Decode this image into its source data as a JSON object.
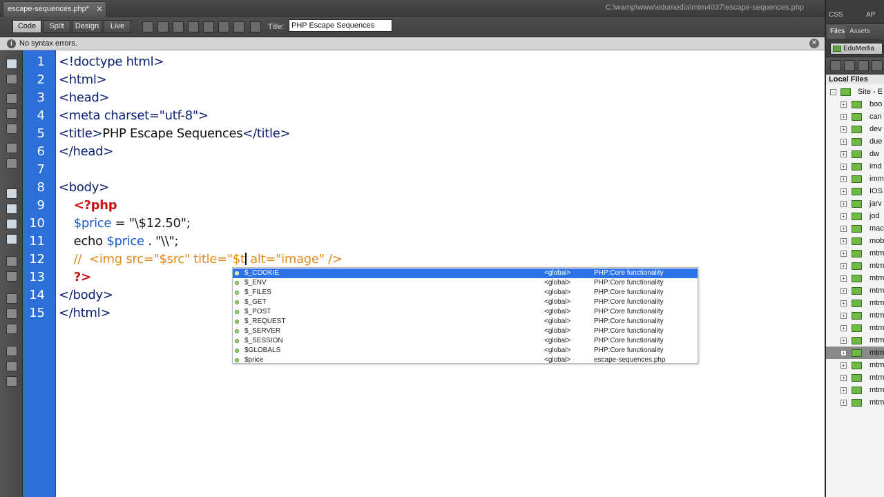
{
  "document_tab": {
    "label": "escape-sequences.php*",
    "close": "✕"
  },
  "path": "C:\\wamp\\www\\edumedia\\mtm4037\\escape-sequences.php",
  "toolbar": {
    "views": [
      "Code",
      "Split",
      "Design",
      "Live"
    ],
    "title_label": "Title:",
    "title_value": "PHP Escape Sequences"
  },
  "syntax": {
    "message": "No syntax errors."
  },
  "code": {
    "line_numbers": [
      "1",
      "2",
      "3",
      "4",
      "5",
      "6",
      "7",
      "8",
      "9",
      "10",
      "11",
      "12",
      "13",
      "14",
      "15"
    ],
    "lines": [
      [
        {
          "t": "<!doctype html>",
          "c": "c-tag"
        }
      ],
      [
        {
          "t": "<html>",
          "c": "c-tag"
        }
      ],
      [
        {
          "t": "<head>",
          "c": "c-tag"
        }
      ],
      [
        {
          "t": "<meta charset=\"utf-8\">",
          "c": "c-tag"
        }
      ],
      [
        {
          "t": "<title>",
          "c": "c-tag"
        },
        {
          "t": "PHP Escape Sequences",
          "c": "c-plain"
        },
        {
          "t": "</title>",
          "c": "c-tag"
        }
      ],
      [
        {
          "t": "</head>",
          "c": "c-tag"
        }
      ],
      [],
      [
        {
          "t": "<body>",
          "c": "c-tag"
        }
      ],
      [
        {
          "t": "    ",
          "c": "c-plain"
        },
        {
          "t": "<?php",
          "c": "c-php"
        }
      ],
      [
        {
          "t": "    ",
          "c": "c-plain"
        },
        {
          "t": "$price",
          "c": "c-var"
        },
        {
          "t": " = ",
          "c": "c-plain"
        },
        {
          "t": "\"\\$12.50\"",
          "c": "c-str"
        },
        {
          "t": ";",
          "c": "c-plain"
        }
      ],
      [
        {
          "t": "    echo ",
          "c": "c-plain"
        },
        {
          "t": "$price",
          "c": "c-var"
        },
        {
          "t": " . ",
          "c": "c-plain"
        },
        {
          "t": "\"\\\\\"",
          "c": "c-str"
        },
        {
          "t": ";",
          "c": "c-plain"
        }
      ],
      [
        {
          "t": "    //  <img src=\"$src\" title=\"$t",
          "c": "c-comment"
        },
        {
          "caret": true
        },
        {
          "t": " alt=\"image\" />",
          "c": "c-comment"
        }
      ],
      [
        {
          "t": "    ",
          "c": "c-plain"
        },
        {
          "t": "?>",
          "c": "c-php"
        }
      ],
      [
        {
          "t": "</body>",
          "c": "c-tag"
        }
      ],
      [
        {
          "t": "</html>",
          "c": "c-tag"
        }
      ]
    ]
  },
  "code_hints": [
    {
      "name": "$_COOKIE",
      "scope": "<global>",
      "source": "PHP:Core functionality",
      "selected": true
    },
    {
      "name": "$_ENV",
      "scope": "<global>",
      "source": "PHP:Core functionality"
    },
    {
      "name": "$_FILES",
      "scope": "<global>",
      "source": "PHP:Core functionality"
    },
    {
      "name": "$_GET",
      "scope": "<global>",
      "source": "PHP:Core functionality"
    },
    {
      "name": "$_POST",
      "scope": "<global>",
      "source": "PHP:Core functionality"
    },
    {
      "name": "$_REQUEST",
      "scope": "<global>",
      "source": "PHP:Core functionality"
    },
    {
      "name": "$_SERVER",
      "scope": "<global>",
      "source": "PHP:Core functionality"
    },
    {
      "name": "$_SESSION",
      "scope": "<global>",
      "source": "PHP:Core functionality"
    },
    {
      "name": "$GLOBALS",
      "scope": "<global>",
      "source": "PHP:Core functionality"
    },
    {
      "name": "$price",
      "scope": "<global>",
      "source": "escape-sequences.php"
    }
  ],
  "right_panel": {
    "tabs": [
      "CSS Styles",
      "AP"
    ],
    "sub_tabs": [
      "Files",
      "Assets"
    ],
    "site_select": "EduMedia",
    "local_files_label": "Local Files",
    "root": "Site - E",
    "folders": [
      "boo",
      "can",
      "dev",
      "due",
      "dw",
      "imd",
      "imm",
      "IOS",
      "jarv",
      "jod",
      "mac",
      "mob",
      "mtm",
      "mtm",
      "mtm",
      "mtm",
      "mtm",
      "mtm",
      "mtm",
      "mtm",
      "mtm",
      "mtm",
      "mtm",
      "mtm",
      "mtm"
    ]
  },
  "colors": {
    "gutter": "#2d6fd8",
    "tag": "#0a1f6e",
    "php_delim": "#cc1111",
    "variable": "#1a5cc8",
    "comment": "#e08a1c",
    "hint_selected": "#2e72e8"
  }
}
